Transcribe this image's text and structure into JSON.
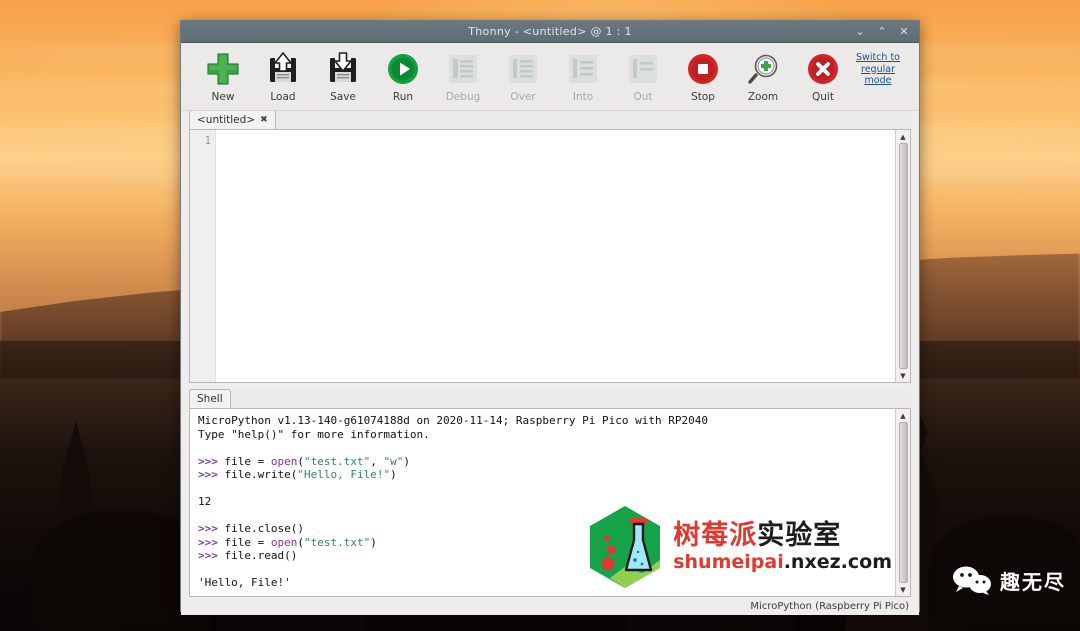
{
  "desktop": {
    "wechat_watermark": {
      "icon": "wechat-icon",
      "label": "趣无尽"
    }
  },
  "window": {
    "title": "Thonny  -  <untitled> @ 1 : 1",
    "controls": [
      {
        "name": "minimize-button",
        "glyph": "⌄"
      },
      {
        "name": "maximize-button",
        "glyph": "⌃"
      },
      {
        "name": "close-button",
        "glyph": "✕"
      }
    ]
  },
  "toolbar": {
    "buttons": [
      {
        "name": "new-button",
        "label": "New",
        "icon": "plus-icon",
        "enabled": true
      },
      {
        "name": "load-button",
        "label": "Load",
        "icon": "floppy-up-arrow-icon",
        "enabled": true
      },
      {
        "name": "save-button",
        "label": "Save",
        "icon": "floppy-down-arrow-icon",
        "enabled": true
      },
      {
        "name": "run-button",
        "label": "Run",
        "icon": "play-circle-icon",
        "enabled": true
      },
      {
        "name": "debug-button",
        "label": "Debug",
        "icon": "debug-list-icon",
        "enabled": false
      },
      {
        "name": "over-button",
        "label": "Over",
        "icon": "step-over-icon",
        "enabled": false
      },
      {
        "name": "into-button",
        "label": "Into",
        "icon": "step-into-icon",
        "enabled": false
      },
      {
        "name": "out-button",
        "label": "Out",
        "icon": "step-out-icon",
        "enabled": false
      },
      {
        "name": "stop-button",
        "label": "Stop",
        "icon": "stop-circle-icon",
        "enabled": true
      },
      {
        "name": "zoom-button",
        "label": "Zoom",
        "icon": "magnifier-plus-icon",
        "enabled": true
      },
      {
        "name": "quit-button",
        "label": "Quit",
        "icon": "close-circle-icon",
        "enabled": true
      }
    ],
    "mode_link": "Switch to regular mode"
  },
  "editor": {
    "tab": {
      "label": "<untitled>",
      "close_glyph": "✖"
    },
    "line_numbers": [
      "1"
    ],
    "content": ""
  },
  "shell": {
    "tab_label": "Shell",
    "lines": [
      {
        "type": "banner",
        "text": "MicroPython v1.13-140-g61074188d on 2020-11-14; Raspberry Pi Pico with RP2040"
      },
      {
        "type": "banner",
        "text": "Type \"help()\" for more information."
      },
      {
        "type": "blank",
        "text": ""
      },
      {
        "type": "input",
        "prompt": ">>> ",
        "code": "file = open(\"test.txt\", \"w\")"
      },
      {
        "type": "input",
        "prompt": ">>> ",
        "code": "file.write(\"Hello, File!\")"
      },
      {
        "type": "blank",
        "text": ""
      },
      {
        "type": "output",
        "text": "12"
      },
      {
        "type": "blank",
        "text": ""
      },
      {
        "type": "input",
        "prompt": ">>> ",
        "code": "file.close()"
      },
      {
        "type": "input",
        "prompt": ">>> ",
        "code": "file = open(\"test.txt\")"
      },
      {
        "type": "input",
        "prompt": ">>> ",
        "code": "file.read()"
      },
      {
        "type": "blank",
        "text": ""
      },
      {
        "type": "output",
        "text": "'Hello, File!'"
      },
      {
        "type": "blank",
        "text": ""
      },
      {
        "type": "input",
        "prompt": ">>> ",
        "code": ""
      }
    ],
    "raw": {
      "l1": "MicroPython v1.13-140-g61074188d on 2020-11-14; Raspberry Pi Pico with RP2040",
      "l2": "Type \"help()\" for more information.",
      "p": ">>> ",
      "c1_a": "file = ",
      "c1_kw": "open",
      "c1_b": "(",
      "c1_s1": "\"test.txt\"",
      "c1_c": ", ",
      "c1_s2": "\"w\"",
      "c1_d": ")",
      "c2_a": "file.write(",
      "c2_s": "\"Hello, File!\"",
      "c2_b": ")",
      "out1": "12",
      "c3": "file.close()",
      "c4_a": "file = ",
      "c4_kw": "open",
      "c4_b": "(",
      "c4_s": "\"test.txt\"",
      "c4_c": ")",
      "c5": "file.read()",
      "out2": "'Hello, File!'"
    },
    "watermark": {
      "cn_red": "树莓派",
      "cn_black": "实验室",
      "url_red": "shumeipai",
      "url_black": ".nxez.com",
      "logo": "flask-hexagon-logo"
    }
  },
  "statusbar": {
    "interpreter": "MicroPython (Raspberry Pi Pico)"
  },
  "colors": {
    "accent_green": "#3aa545",
    "accent_red": "#d0262a",
    "prompt_purple": "#7b3fa0",
    "string_green": "#2e8b57",
    "keyword_purple": "#9b2d86",
    "link_blue": "#1a4f93",
    "titlebar": "#5f6e74"
  }
}
